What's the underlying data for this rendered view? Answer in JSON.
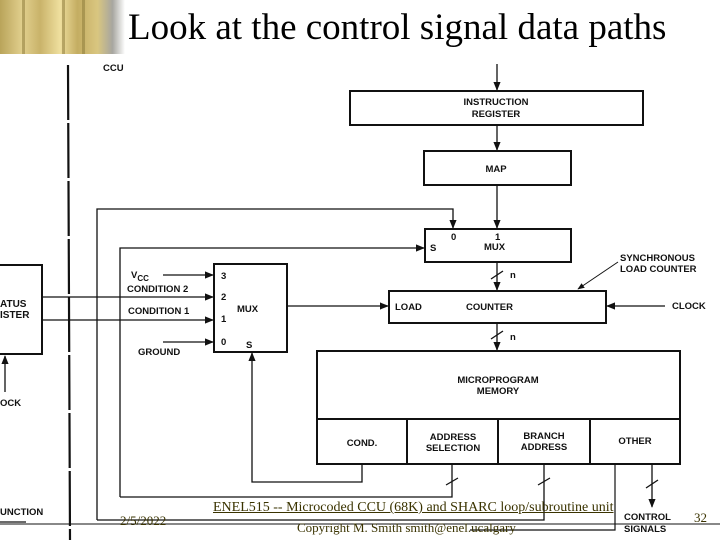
{
  "slide": {
    "title": "Look at the control signal data paths",
    "footer": {
      "course": "ENEL515 -- Microcoded CCU (68K) and SHARC loop/subroutine unit",
      "date": "2/5/2022",
      "copyright": "Copyright M. Smith smith@enel.ucalgary",
      "page_number": "32"
    }
  },
  "diagram": {
    "ccu_label": "CCU",
    "instruction_register": [
      "INSTRUCTION",
      "REGISTER"
    ],
    "map": "MAP",
    "top_mux": {
      "label": "MUX",
      "input_0": "0",
      "input_1": "1",
      "select": "S"
    },
    "counter": {
      "load": "LOAD",
      "label": "COUNTER"
    },
    "bus_width": "n",
    "sync_counter_note": [
      "SYNCHRONOUS",
      "LOAD COUNTER"
    ],
    "clock": "CLOCK",
    "cond_mux": {
      "label": "MUX",
      "inputs": [
        "3",
        "2",
        "1",
        "0"
      ],
      "select": "S",
      "vcc": "V",
      "vcc_sub": "CC",
      "condition2": "CONDITION 2",
      "condition1": "CONDITION 1",
      "ground": "GROUND"
    },
    "status_register": [
      "ATUS",
      "ISTER"
    ],
    "status_clock": "OCK",
    "function_label": "UNCTION",
    "microprogram_memory": [
      "MICROPROGRAM",
      "MEMORY"
    ],
    "fields": [
      {
        "label": [
          "COND."
        ]
      },
      {
        "label": [
          "ADDRESS",
          "SELECTION"
        ]
      },
      {
        "label": [
          "BRANCH",
          "ADDRESS"
        ]
      },
      {
        "label": [
          "OTHER"
        ]
      }
    ],
    "control_signals": [
      "CONTROL",
      "SIGNALS"
    ]
  }
}
